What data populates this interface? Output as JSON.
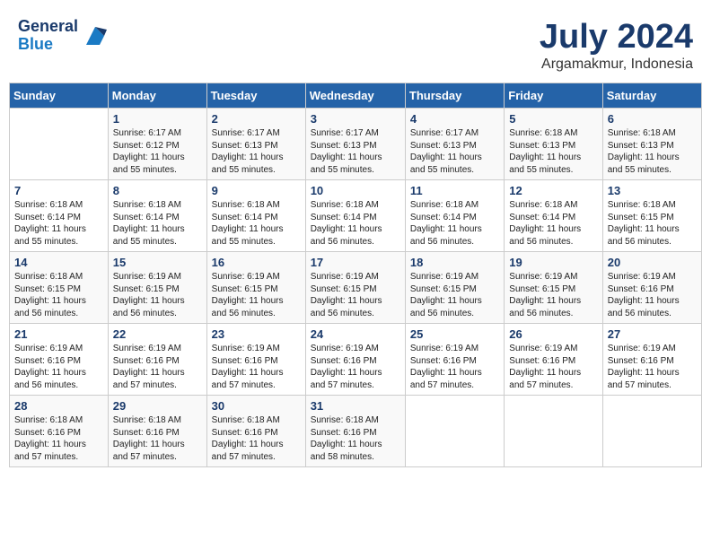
{
  "header": {
    "logo_line1": "General",
    "logo_line2": "Blue",
    "month_year": "July 2024",
    "location": "Argamakmur, Indonesia"
  },
  "weekdays": [
    "Sunday",
    "Monday",
    "Tuesday",
    "Wednesday",
    "Thursday",
    "Friday",
    "Saturday"
  ],
  "weeks": [
    [
      {
        "day": "",
        "info": ""
      },
      {
        "day": "1",
        "info": "Sunrise: 6:17 AM\nSunset: 6:12 PM\nDaylight: 11 hours\nand 55 minutes."
      },
      {
        "day": "2",
        "info": "Sunrise: 6:17 AM\nSunset: 6:13 PM\nDaylight: 11 hours\nand 55 minutes."
      },
      {
        "day": "3",
        "info": "Sunrise: 6:17 AM\nSunset: 6:13 PM\nDaylight: 11 hours\nand 55 minutes."
      },
      {
        "day": "4",
        "info": "Sunrise: 6:17 AM\nSunset: 6:13 PM\nDaylight: 11 hours\nand 55 minutes."
      },
      {
        "day": "5",
        "info": "Sunrise: 6:18 AM\nSunset: 6:13 PM\nDaylight: 11 hours\nand 55 minutes."
      },
      {
        "day": "6",
        "info": "Sunrise: 6:18 AM\nSunset: 6:13 PM\nDaylight: 11 hours\nand 55 minutes."
      }
    ],
    [
      {
        "day": "7",
        "info": "Sunrise: 6:18 AM\nSunset: 6:14 PM\nDaylight: 11 hours\nand 55 minutes."
      },
      {
        "day": "8",
        "info": "Sunrise: 6:18 AM\nSunset: 6:14 PM\nDaylight: 11 hours\nand 55 minutes."
      },
      {
        "day": "9",
        "info": "Sunrise: 6:18 AM\nSunset: 6:14 PM\nDaylight: 11 hours\nand 55 minutes."
      },
      {
        "day": "10",
        "info": "Sunrise: 6:18 AM\nSunset: 6:14 PM\nDaylight: 11 hours\nand 56 minutes."
      },
      {
        "day": "11",
        "info": "Sunrise: 6:18 AM\nSunset: 6:14 PM\nDaylight: 11 hours\nand 56 minutes."
      },
      {
        "day": "12",
        "info": "Sunrise: 6:18 AM\nSunset: 6:14 PM\nDaylight: 11 hours\nand 56 minutes."
      },
      {
        "day": "13",
        "info": "Sunrise: 6:18 AM\nSunset: 6:15 PM\nDaylight: 11 hours\nand 56 minutes."
      }
    ],
    [
      {
        "day": "14",
        "info": "Sunrise: 6:18 AM\nSunset: 6:15 PM\nDaylight: 11 hours\nand 56 minutes."
      },
      {
        "day": "15",
        "info": "Sunrise: 6:19 AM\nSunset: 6:15 PM\nDaylight: 11 hours\nand 56 minutes."
      },
      {
        "day": "16",
        "info": "Sunrise: 6:19 AM\nSunset: 6:15 PM\nDaylight: 11 hours\nand 56 minutes."
      },
      {
        "day": "17",
        "info": "Sunrise: 6:19 AM\nSunset: 6:15 PM\nDaylight: 11 hours\nand 56 minutes."
      },
      {
        "day": "18",
        "info": "Sunrise: 6:19 AM\nSunset: 6:15 PM\nDaylight: 11 hours\nand 56 minutes."
      },
      {
        "day": "19",
        "info": "Sunrise: 6:19 AM\nSunset: 6:15 PM\nDaylight: 11 hours\nand 56 minutes."
      },
      {
        "day": "20",
        "info": "Sunrise: 6:19 AM\nSunset: 6:16 PM\nDaylight: 11 hours\nand 56 minutes."
      }
    ],
    [
      {
        "day": "21",
        "info": "Sunrise: 6:19 AM\nSunset: 6:16 PM\nDaylight: 11 hours\nand 56 minutes."
      },
      {
        "day": "22",
        "info": "Sunrise: 6:19 AM\nSunset: 6:16 PM\nDaylight: 11 hours\nand 57 minutes."
      },
      {
        "day": "23",
        "info": "Sunrise: 6:19 AM\nSunset: 6:16 PM\nDaylight: 11 hours\nand 57 minutes."
      },
      {
        "day": "24",
        "info": "Sunrise: 6:19 AM\nSunset: 6:16 PM\nDaylight: 11 hours\nand 57 minutes."
      },
      {
        "day": "25",
        "info": "Sunrise: 6:19 AM\nSunset: 6:16 PM\nDaylight: 11 hours\nand 57 minutes."
      },
      {
        "day": "26",
        "info": "Sunrise: 6:19 AM\nSunset: 6:16 PM\nDaylight: 11 hours\nand 57 minutes."
      },
      {
        "day": "27",
        "info": "Sunrise: 6:19 AM\nSunset: 6:16 PM\nDaylight: 11 hours\nand 57 minutes."
      }
    ],
    [
      {
        "day": "28",
        "info": "Sunrise: 6:18 AM\nSunset: 6:16 PM\nDaylight: 11 hours\nand 57 minutes."
      },
      {
        "day": "29",
        "info": "Sunrise: 6:18 AM\nSunset: 6:16 PM\nDaylight: 11 hours\nand 57 minutes."
      },
      {
        "day": "30",
        "info": "Sunrise: 6:18 AM\nSunset: 6:16 PM\nDaylight: 11 hours\nand 57 minutes."
      },
      {
        "day": "31",
        "info": "Sunrise: 6:18 AM\nSunset: 6:16 PM\nDaylight: 11 hours\nand 58 minutes."
      },
      {
        "day": "",
        "info": ""
      },
      {
        "day": "",
        "info": ""
      },
      {
        "day": "",
        "info": ""
      }
    ]
  ]
}
